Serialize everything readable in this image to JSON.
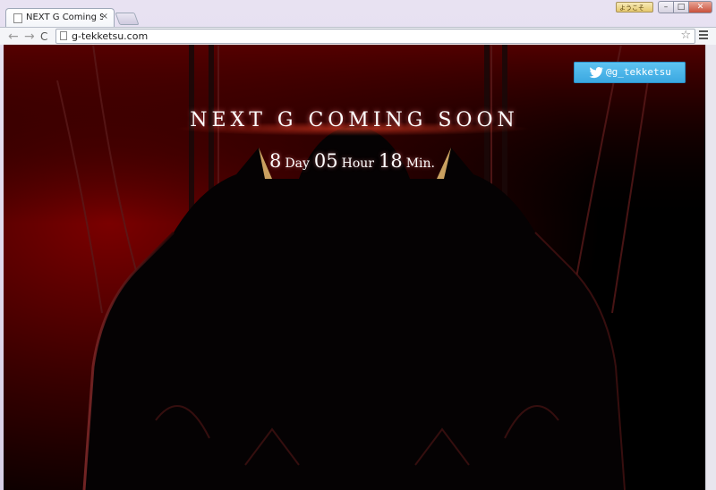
{
  "browser": {
    "tab_title": "NEXT G Coming Soon",
    "tab_close": "×",
    "profile_label": "ようこそ",
    "url": "g-tekketsu.com",
    "window_min": "–",
    "window_max": "□",
    "window_close": "✕"
  },
  "page": {
    "headline": "NEXT G COMING SOON",
    "countdown": {
      "days": "8",
      "days_unit": "Day",
      "hours": "05",
      "hours_unit": "Hour",
      "minutes": "18",
      "minutes_unit": "Min."
    },
    "twitter_label": "@g_tekketsu"
  },
  "colors": {
    "twitter_blue": "#45b2e8",
    "bg_dark": "#000000",
    "bg_red": "#6e0000"
  },
  "icons": [
    "back-arrow-icon",
    "forward-arrow-icon",
    "reload-icon",
    "page-icon",
    "star-icon",
    "menu-icon",
    "twitter-bird-icon"
  ]
}
